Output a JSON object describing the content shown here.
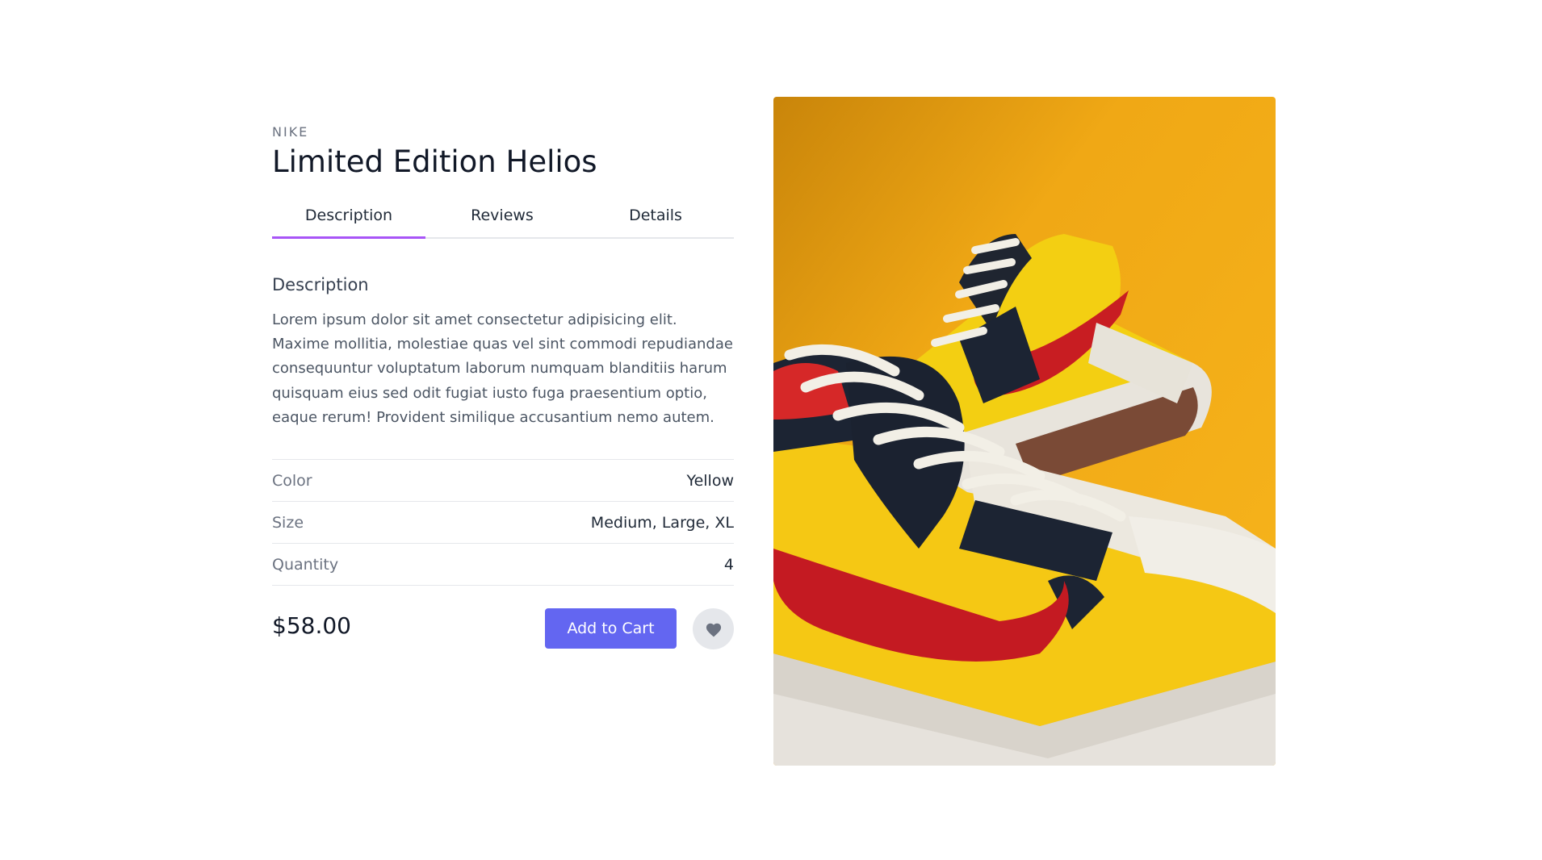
{
  "product": {
    "brand": "NIKE",
    "title": "Limited Edition Helios",
    "price": "$58.00"
  },
  "tabs": [
    {
      "label": "Description",
      "active": true
    },
    {
      "label": "Reviews",
      "active": false
    },
    {
      "label": "Details",
      "active": false
    }
  ],
  "description": {
    "heading": "Description",
    "text": "Lorem ipsum dolor sit amet consectetur adipisicing elit. Maxime mollitia, molestiae quas vel sint commodi repudiandae consequuntur voluptatum laborum numquam blanditiis harum quisquam eius sed odit fugiat iusto fuga praesentium optio, eaque rerum! Provident similique accusantium nemo autem."
  },
  "specs": [
    {
      "label": "Color",
      "value": "Yellow"
    },
    {
      "label": "Size",
      "value": "Medium, Large, XL"
    },
    {
      "label": "Quantity",
      "value": "4"
    }
  ],
  "actions": {
    "add_to_cart_label": "Add to Cart",
    "wishlist_icon": "heart-icon"
  },
  "colors": {
    "accent": "#6366f1",
    "tab_underline": "#a855f7",
    "image_background": "#f5b21a"
  },
  "image": {
    "subject": "sneaker-photo"
  }
}
